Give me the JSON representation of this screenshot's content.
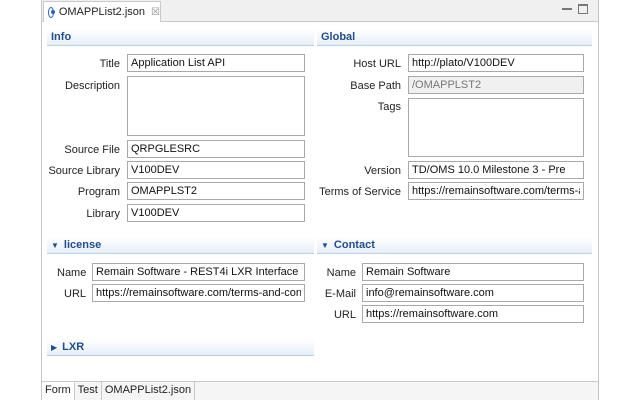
{
  "tab": {
    "title": "OMAPPList2.json",
    "close": "☒"
  },
  "info": {
    "header": "Info",
    "title_label": "Title",
    "title_value": "Application List API",
    "description_label": "Description",
    "description_value": "",
    "source_file_label": "Source File",
    "source_file_value": "QRPGLESRC",
    "source_library_label": "Source Library",
    "source_library_value": "V100DEV",
    "program_label": "Program",
    "program_value": "OMAPPLST2",
    "library_label": "Library",
    "library_value": "V100DEV"
  },
  "global": {
    "header": "Global",
    "host_url_label": "Host URL",
    "host_url_value": "http://plato/V100DEV",
    "base_path_label": "Base Path",
    "base_path_value": "/OMAPPLST2",
    "tags_label": "Tags",
    "tags_value": "",
    "version_label": "Version",
    "version_value": "TD/OMS 10.0 Milestone 3 - Pre",
    "terms_label": "Terms of Service",
    "terms_value": "https://remainsoftware.com/terms-an"
  },
  "license": {
    "header": "license",
    "name_label": "Name",
    "name_value": "Remain Software - REST4i LXR Interface",
    "url_label": "URL",
    "url_value": "https://remainsoftware.com/terms-and-condi"
  },
  "contact": {
    "header": "Contact",
    "name_label": "Name",
    "name_value": "Remain Software",
    "email_label": "E-Mail",
    "email_value": "info@remainsoftware.com",
    "url_label": "URL",
    "url_value": "https://remainsoftware.com"
  },
  "lxr": {
    "header": "LXR"
  },
  "bottom_tabs": {
    "form": "Form",
    "test": "Test",
    "source": "OMAPPList2.json"
  }
}
